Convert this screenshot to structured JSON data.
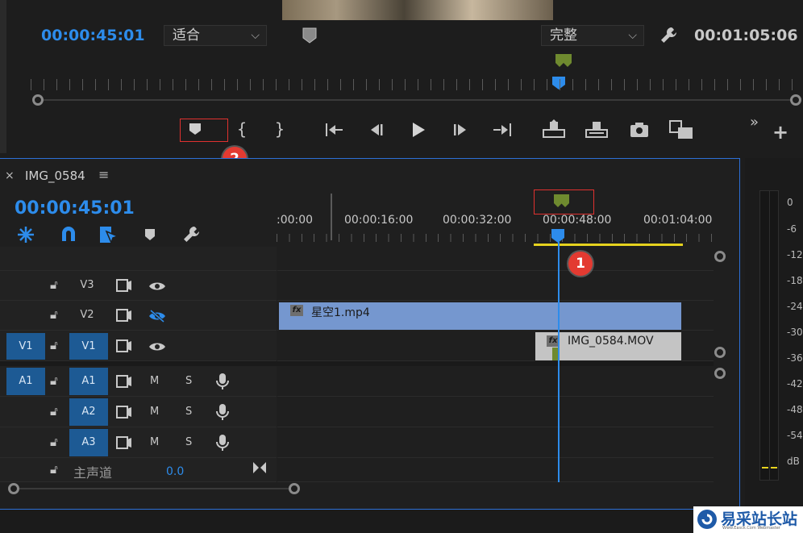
{
  "program_monitor": {
    "timecode_current": "00:00:45:01",
    "fit_dropdown": "适合",
    "quality_dropdown": "完整",
    "timecode_duration": "00:01:05:06"
  },
  "annotations": {
    "badge_1": "1",
    "badge_2": "2"
  },
  "sequence": {
    "close_glyph": "×",
    "name": "IMG_0584",
    "menu_glyph": "≡",
    "timecode": "00:00:45:01",
    "ruler_ticks": [
      ":00:00",
      "00:00:16:00",
      "00:00:32:00",
      "00:00:48:00",
      "00:01:04:00"
    ]
  },
  "tracks": {
    "video": [
      {
        "name": "V3",
        "source": ""
      },
      {
        "name": "V2",
        "source": ""
      },
      {
        "name": "V1",
        "source": "V1"
      }
    ],
    "audio": [
      {
        "name": "A1",
        "source": "A1",
        "m": "M",
        "s": "S"
      },
      {
        "name": "A2",
        "source": "",
        "m": "M",
        "s": "S"
      },
      {
        "name": "A3",
        "source": "",
        "m": "M",
        "s": "S"
      }
    ],
    "master": {
      "label": "主声道",
      "value": "0.0"
    }
  },
  "clips": [
    {
      "name": "星空1.mp4",
      "fx": "fx"
    },
    {
      "name": "IMG_0584.MOV",
      "fx": "fx"
    }
  ],
  "audio_meter": {
    "scale": [
      "0",
      "-6",
      "-12",
      "-18",
      "-24",
      "-30",
      "-36",
      "-42",
      "-48",
      "-54",
      "dB"
    ]
  },
  "watermark": {
    "text": "易采站长站",
    "sub": "Www.Easck.Com Webmaster"
  },
  "colors": {
    "accent_blue": "#2d8ceb",
    "marker_green": "#6f8a2f",
    "work_area": "#e6d21e",
    "annotation_red": "#e0312f"
  }
}
